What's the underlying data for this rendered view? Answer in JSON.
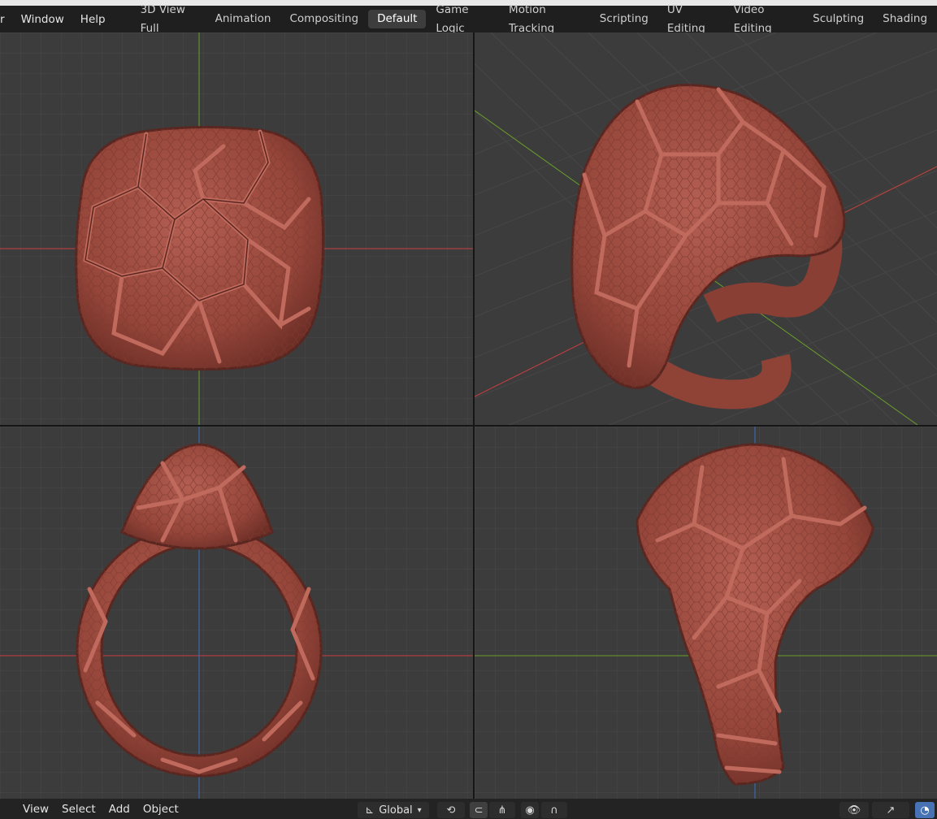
{
  "top_menu": {
    "partial_item": "r",
    "window": "Window",
    "help": "Help"
  },
  "workspace_tabs": [
    {
      "label": "3D View Full",
      "active": false
    },
    {
      "label": "Animation",
      "active": false
    },
    {
      "label": "Compositing",
      "active": false
    },
    {
      "label": "Default",
      "active": true
    },
    {
      "label": "Game Logic",
      "active": false
    },
    {
      "label": "Motion Tracking",
      "active": false
    },
    {
      "label": "Scripting",
      "active": false
    },
    {
      "label": "UV Editing",
      "active": false
    },
    {
      "label": "Video Editing",
      "active": false
    },
    {
      "label": "Sculpting",
      "active": false
    },
    {
      "label": "Shading",
      "active": false
    }
  ],
  "viewports": [
    {
      "name": "top-view",
      "axes": [
        "x-red",
        "y-green"
      ]
    },
    {
      "name": "perspective-view",
      "axes": [
        "x-red",
        "y-green"
      ]
    },
    {
      "name": "front-view",
      "axes": [
        "x-red",
        "z-blue"
      ]
    },
    {
      "name": "side-view",
      "axes": [
        "y-green",
        "z-blue"
      ]
    }
  ],
  "header": {
    "view": "View",
    "select": "Select",
    "add": "Add",
    "object": "Object",
    "transform_orientation": "Global"
  },
  "icons": {
    "transform_pivot": "transform-orientation-icon",
    "snap": "snap-icon",
    "proportional": "proportional-editing-icon",
    "visibility": "eye-icon",
    "gizmo": "gizmo-icon",
    "overlays": "overlays-icon"
  },
  "colors": {
    "viewport_bg": "#3c3c3c",
    "grid": "#474747",
    "axis_x": "#c94040",
    "axis_y": "#6a9e2a",
    "axis_z": "#3c6fbf",
    "ring": "#9a4a40",
    "ring_highlight": "#b9665a",
    "ring_shadow": "#5a2620",
    "active_tab": "#3d3d3d"
  }
}
